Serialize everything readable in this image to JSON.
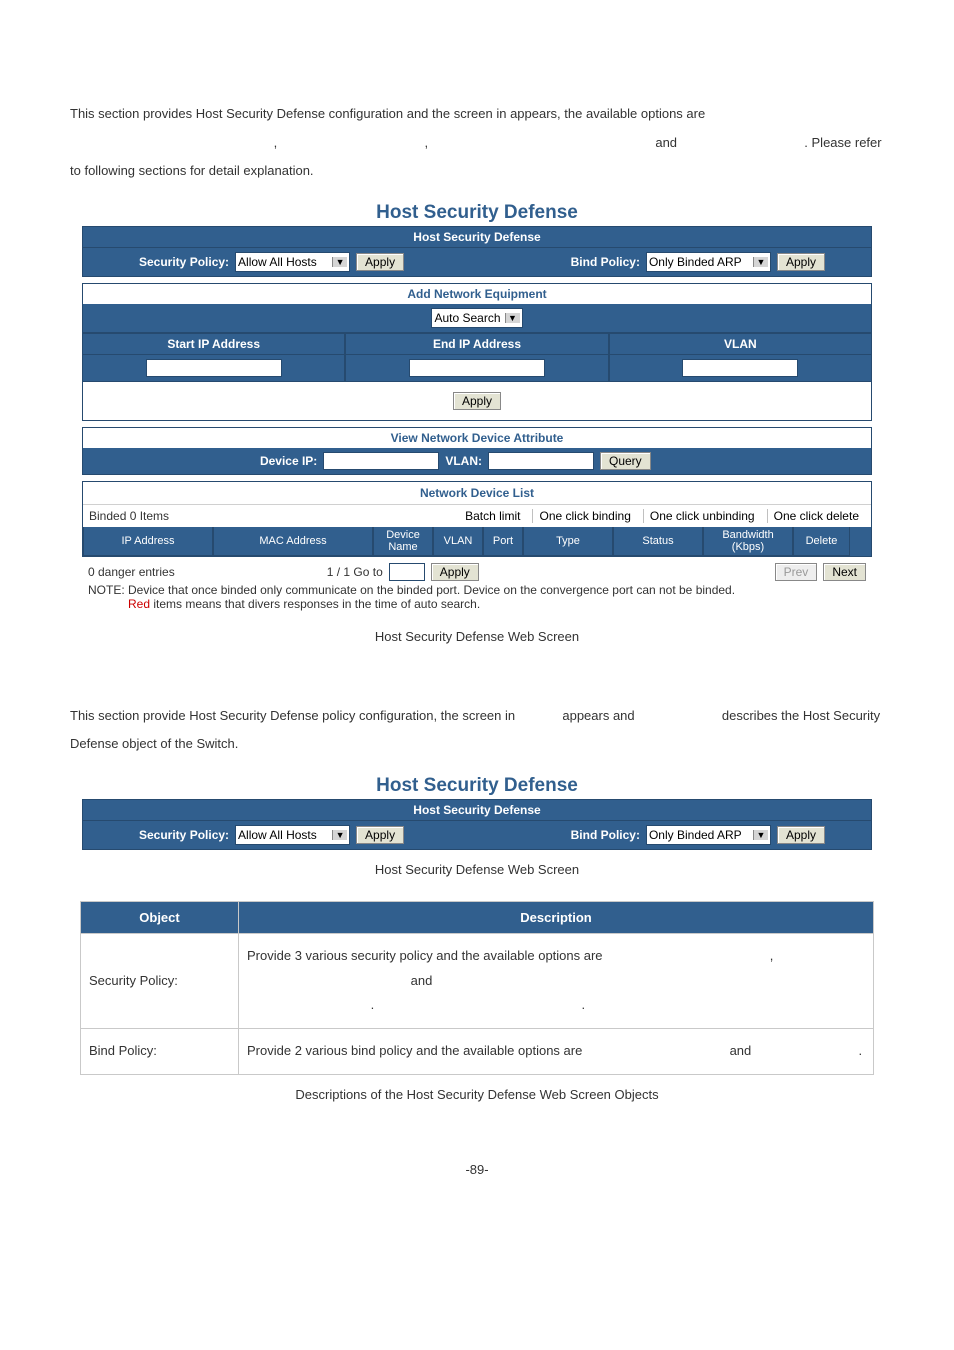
{
  "intro": {
    "line1a": "This section provides Host Security Defense configuration and the screen in ",
    "line1b": " appears, the available options are ",
    "comma1": " , ",
    "comma2": " , ",
    "and": " and ",
    "line2": " . Please refer to following sections for detail explanation."
  },
  "panel_title": "Host Security Defense",
  "sec_head": "Host Security Defense",
  "policy": {
    "sec_label": "Security Policy:",
    "sec_value": "Allow All Hosts",
    "apply": "Apply",
    "bind_label": "Bind Policy:",
    "bind_value": "Only Binded ARP",
    "apply2": "Apply"
  },
  "add_eq": {
    "title": "Add Network Equipment",
    "mode": "Auto Search",
    "start": "Start IP Address",
    "end": "End IP Address",
    "vlan": "VLAN",
    "apply": "Apply"
  },
  "view_attr": {
    "title": "View Network Device Attribute",
    "dev_ip": "Device IP:",
    "vlan": "VLAN:",
    "query": "Query"
  },
  "ndl": {
    "title": "Network Device List",
    "binded": "Binded 0 Items",
    "batch": "Batch limit",
    "b1": "One click binding",
    "b2": "One click unbinding",
    "b3": "One click delete",
    "cols": {
      "ip": "IP Address",
      "mac": "MAC Address",
      "dev": "Device Name",
      "vlan": "VLAN",
      "port": "Port",
      "type": "Type",
      "status": "Status",
      "bw": "Bandwidth (Kbps)",
      "del": "Delete"
    }
  },
  "bottom": {
    "danger": "0 danger entries",
    "pages": "1 / 1 Go to",
    "apply": "Apply",
    "prev": "Prev",
    "next": "Next",
    "note1": "NOTE: Device that once binded only communicate on the binded port. Device on the convergence port can not be binded.",
    "note2_red": "Red",
    "note2_rest": " items means that divers responses in the time of auto search."
  },
  "caption1": "Host Security Defense Web Screen",
  "p2": {
    "line1a": "This section provide Host Security Defense policy configuration, the screen in ",
    "appears_and": " appears and ",
    "describes": " describes the Host Security Defense object of the Switch."
  },
  "caption2": "Host Security Defense Web Screen",
  "objtable": {
    "h1": "Object",
    "h2": "Description",
    "r1_c1": "Security Policy:",
    "r1_c2a": "Provide 3 various security policy and the available options are ",
    "r1_c2_comma": " , ",
    "r1_c2_and": " and ",
    "r1_c2_dot1": " . ",
    "r1_c2_dot2": " .",
    "r2_c1": "Bind Policy:",
    "r2_c2a": "Provide 2 various bind policy and the available options are ",
    "r2_c2_and": " and ",
    "r2_c2_dot": " ."
  },
  "caption3": "Descriptions of the Host Security Defense Web Screen Objects",
  "page_num": "-89-"
}
